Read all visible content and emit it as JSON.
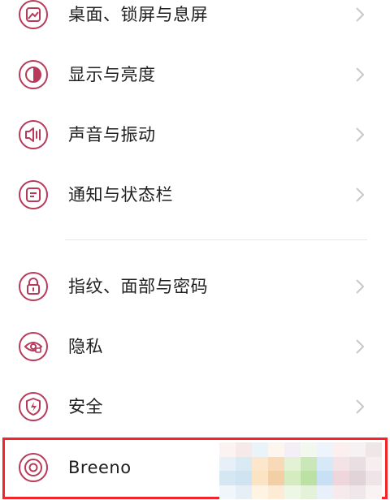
{
  "colors": {
    "accent": "#b83a5b",
    "text": "#1f1f1f",
    "chevron": "#c8c8c8",
    "highlight_border": "#f2252a"
  },
  "settings": {
    "items": [
      {
        "label": "桌面、锁屏与息屏",
        "icon": "wallpaper-icon"
      },
      {
        "label": "显示与亮度",
        "icon": "brightness-icon"
      },
      {
        "label": "声音与振动",
        "icon": "speaker-icon"
      },
      {
        "label": "通知与状态栏",
        "icon": "notification-icon"
      },
      {
        "label": "指纹、面部与密码",
        "icon": "lock-icon"
      },
      {
        "label": "隐私",
        "icon": "privacy-eye-icon"
      },
      {
        "label": "安全",
        "icon": "security-bolt-icon"
      },
      {
        "label": "Breeno",
        "icon": "breeno-icon"
      }
    ]
  }
}
